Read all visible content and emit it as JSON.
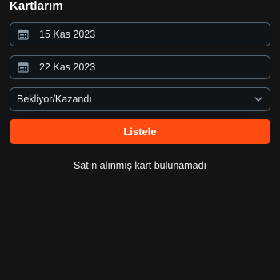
{
  "page": {
    "title": "Kartlarım"
  },
  "filters": {
    "start_date": "15 Kas 2023",
    "end_date": "22 Kas 2023",
    "status_select": {
      "selected": "Bekliyor/Kazandı",
      "icon": "chevron-down-icon"
    },
    "date_icon": "calendar-icon"
  },
  "actions": {
    "list_label": "Listele"
  },
  "results": {
    "empty_message": "Satın alınmış kart bulunamadı"
  },
  "colors": {
    "background": "#141414",
    "field_background": "#0f1418",
    "field_border": "#4f6474",
    "accent": "#ff4d12",
    "text": "#ffffff"
  }
}
